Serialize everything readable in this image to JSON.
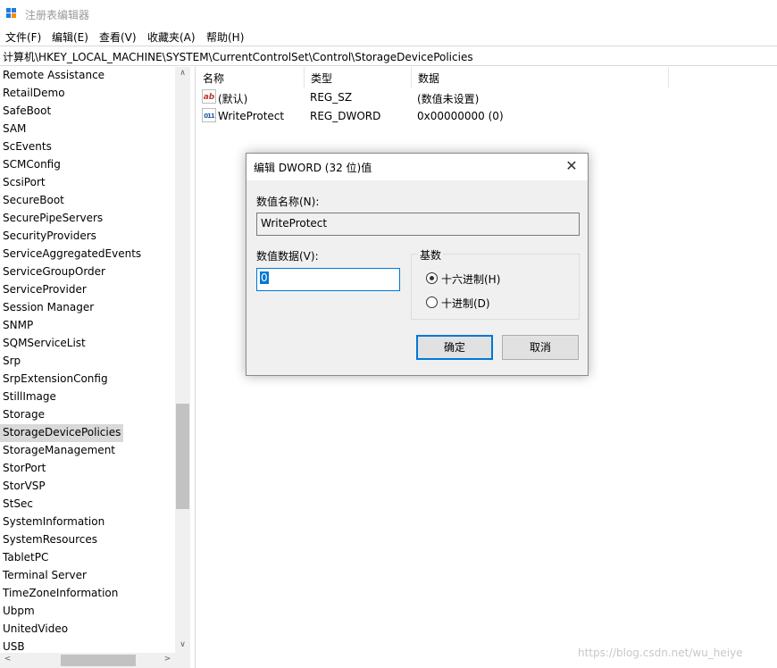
{
  "window": {
    "title": "注册表编辑器"
  },
  "menu": [
    "文件(F)",
    "编辑(E)",
    "查看(V)",
    "收藏夹(A)",
    "帮助(H)"
  ],
  "address": "计算机\\HKEY_LOCAL_MACHINE\\SYSTEM\\CurrentControlSet\\Control\\StorageDevicePolicies",
  "tree": {
    "items": [
      "Remote Assistance",
      "RetailDemo",
      "SafeBoot",
      "SAM",
      "ScEvents",
      "SCMConfig",
      "ScsiPort",
      "SecureBoot",
      "SecurePipeServers",
      "SecurityProviders",
      "ServiceAggregatedEvents",
      "ServiceGroupOrder",
      "ServiceProvider",
      "Session Manager",
      "SNMP",
      "SQMServiceList",
      "Srp",
      "SrpExtensionConfig",
      "StillImage",
      "Storage",
      "StorageDevicePolicies",
      "StorageManagement",
      "StorPort",
      "StorVSP",
      "StSec",
      "SystemInformation",
      "SystemResources",
      "TabletPC",
      "Terminal Server",
      "TimeZoneInformation",
      "Ubpm",
      "UnitedVideo",
      "USB"
    ],
    "selected": "StorageDevicePolicies"
  },
  "list": {
    "headers": {
      "name": "名称",
      "type": "类型",
      "data": "数据"
    },
    "rows": [
      {
        "icon": "string-value-icon",
        "glyph": "ab",
        "name": "(默认)",
        "type": "REG_SZ",
        "data": "(数值未设置)"
      },
      {
        "icon": "dword-value-icon",
        "glyph": "011",
        "name": "WriteProtect",
        "type": "REG_DWORD",
        "data": "0x00000000 (0)"
      }
    ]
  },
  "dialog": {
    "title": "编辑 DWORD (32 位)值",
    "close_glyph": "✕",
    "value_name_label": "数值名称(N):",
    "value_name": "WriteProtect",
    "value_data_label": "数值数据(V):",
    "value_data": "0",
    "base_label": "基数",
    "base_options": [
      "十六进制(H)",
      "十进制(D)"
    ],
    "base_selected": "十六进制(H)",
    "ok_label": "确定",
    "cancel_label": "取消"
  },
  "scroll": {
    "up": "∧",
    "down": "∨",
    "left": "<",
    "right": ">"
  },
  "watermark": "https://blog.csdn.net/wu_heiye",
  "colors": {
    "accent": "#0078d7",
    "selection": "#d9d9d9",
    "dialog_bg": "#f0f0f0"
  }
}
